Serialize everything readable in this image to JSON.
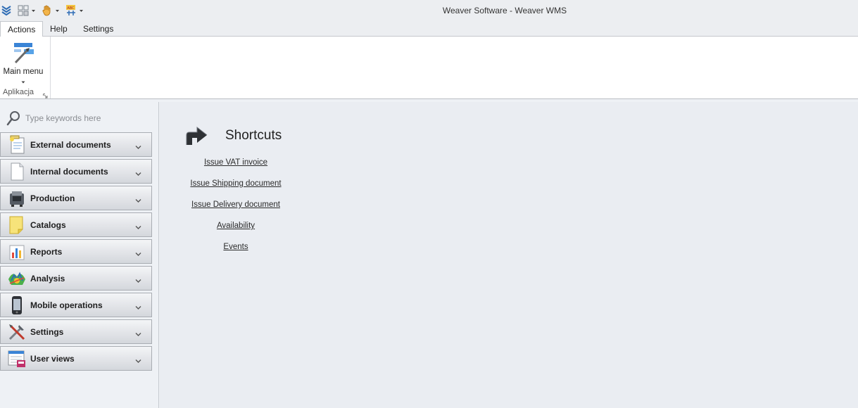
{
  "window": {
    "title": "Weaver Software - Weaver WMS"
  },
  "quick_access": [
    {
      "icon": "app-chevrons-icon"
    },
    {
      "icon": "layout-icon"
    },
    {
      "icon": "hand-icon"
    },
    {
      "icon": "abc-spell-icon"
    }
  ],
  "ribbon": {
    "tabs": [
      {
        "label": "Actions",
        "active": true
      },
      {
        "label": "Help",
        "active": false
      },
      {
        "label": "Settings",
        "active": false
      }
    ],
    "group": {
      "label": "Aplikacja",
      "main_menu_label": "Main menu"
    }
  },
  "sidebar": {
    "search_placeholder": "Type keywords here",
    "items": [
      {
        "label": "External documents",
        "icon": "external-documents-icon"
      },
      {
        "label": "Internal documents",
        "icon": "internal-documents-icon"
      },
      {
        "label": "Production",
        "icon": "production-icon"
      },
      {
        "label": "Catalogs",
        "icon": "catalogs-icon"
      },
      {
        "label": "Reports",
        "icon": "reports-icon"
      },
      {
        "label": "Analysis",
        "icon": "analysis-icon"
      },
      {
        "label": "Mobile operations",
        "icon": "mobile-operations-icon"
      },
      {
        "label": "Settings",
        "icon": "settings-icon"
      },
      {
        "label": "User views",
        "icon": "user-views-icon"
      }
    ]
  },
  "main": {
    "title": "Shortcuts",
    "shortcuts": [
      "Issue VAT invoice",
      "Issue Shipping document",
      "Issue Delivery document",
      "Availability",
      "Events"
    ]
  },
  "colors": {
    "accent_blue": "#2f6db5",
    "background": "#eaedf2",
    "ribbon": "#ffffff"
  }
}
